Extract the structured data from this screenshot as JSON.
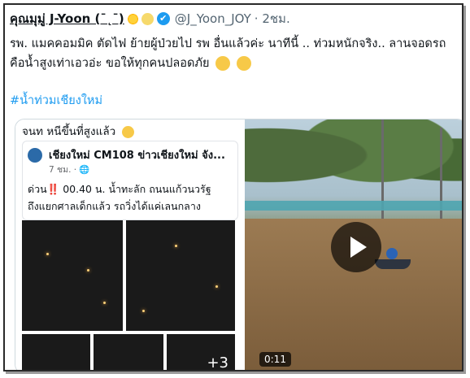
{
  "tweet": {
    "display_name": "คุณมุมู่ J-Yoon (¯˛¯)",
    "handle": "@J_Yoon_JOY",
    "time": "· 2ชม.",
    "text_line1": "รพ. แมคคอมมิค ตัดไฟ ย้ายผู้ป่วยไป รพ อื่นแล้วค่ะ นาทีนี้ .. ท่วมหนักจริง.. ลานจอดรถ",
    "text_line2": "คือน้ำสูงเท่าเอวอ่ะ  ขอให้ทุกคนปลอดภัย",
    "hashtag": "#น้ำท่วมเชียงใหม่"
  },
  "media": {
    "left_caption": "จนท  หนีขึ้นที่สูงแล้ว",
    "card": {
      "title": "เชียงใหม่ CM108 ข่าวเชียงใหม่ จัง...",
      "meta": "7 ชม. · ",
      "text_line1": "ด่วน‼️ 00.40 น. น้ำทะลัก ถนนแก้วนวรัฐ",
      "text_line2": "ถึงแยกศาลเด็กแล้ว รถวิ่งได้แค่เลนกลาง"
    },
    "more_count": "+3",
    "video_duration": "0:11"
  },
  "colors": {
    "link": "#1d9bf0",
    "verified": "#1d9bf0",
    "muted": "#536471"
  }
}
